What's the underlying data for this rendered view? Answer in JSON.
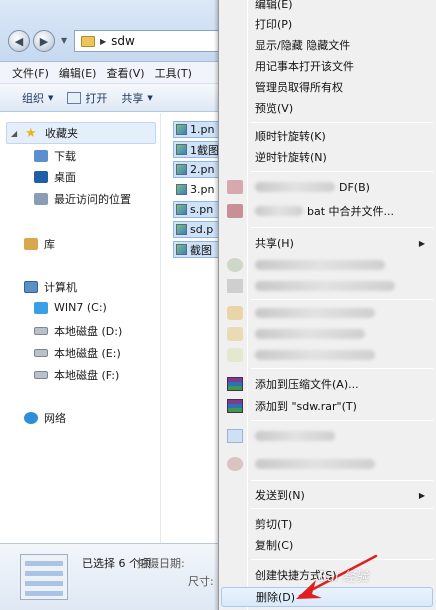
{
  "address_bar": {
    "path": "sdw"
  },
  "menubar": [
    "文件(F)",
    "编辑(E)",
    "查看(V)",
    "工具(T)"
  ],
  "toolbar": {
    "organize": "组织",
    "open": "打开",
    "share": "共享"
  },
  "nav_pane": {
    "favorites": "收藏夹",
    "downloads": "下载",
    "desktop": "桌面",
    "recent": "最近访问的位置",
    "libraries": "库",
    "computer": "计算机",
    "drive_c": "WIN7 (C:)",
    "drive_d": "本地磁盘 (D:)",
    "drive_e": "本地磁盘 (E:)",
    "drive_f": "本地磁盘 (F:)",
    "network": "网络"
  },
  "files": [
    "1.pn",
    "1截图",
    "2.pn",
    "3.pn",
    "s.pn",
    "sd.p",
    "截图"
  ],
  "details_pane": {
    "selection": "已选择 6 个项",
    "date_label": "拍摄日期:",
    "size_label": "尺寸:"
  },
  "context_menu": {
    "edit": "编辑(E)",
    "print": "打印(P)",
    "show_hide": "显示/隐藏 隐藏文件",
    "notepad": "用记事本打开该文件",
    "take_ownership": "管理员取得所有权",
    "preview": "预览(V)",
    "rotate_cw": "顺时针旋转(K)",
    "rotate_ccw": "逆时针旋转(N)",
    "pdf_fragment": "DF(B)",
    "bat_fragment": "bat 中合并文件...",
    "share": "共享(H)",
    "add_archive": "添加到压缩文件(A)...",
    "add_rar": "添加到 \"sdw.rar\"(T)",
    "send_to": "发送到(N)",
    "cut": "剪切(T)",
    "copy": "复制(C)",
    "create_shortcut": "创建快捷方式(S)",
    "delete": "删除(D)"
  },
  "watermark": "Bai 经验",
  "colors": {
    "highlight": "#d9e9fb",
    "arrow": "#e02020"
  }
}
